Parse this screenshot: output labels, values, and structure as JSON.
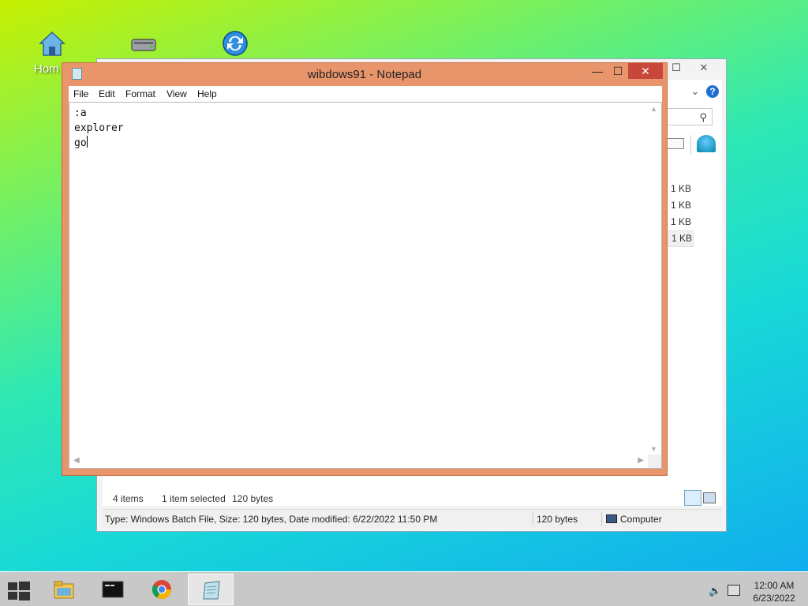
{
  "desktop": {
    "icons": [
      {
        "name": "home-icon",
        "label": "Hom"
      },
      {
        "name": "drive-icon",
        "label": ""
      },
      {
        "name": "sync-icon",
        "label": ""
      }
    ]
  },
  "explorer": {
    "maximize_glyph": "☐",
    "close_glyph": "✕",
    "chevron": "⌄",
    "help": "?",
    "search_icon": "⚲",
    "sizes": [
      "1 KB",
      "1 KB",
      "1 KB",
      "1 KB"
    ],
    "status": {
      "items": "4 items",
      "selected": "1 item selected",
      "bytes": "120 bytes"
    },
    "info": {
      "type_text": "Type: Windows Batch File, Size: 120 bytes, Date modified: 6/22/2022 11:50 PM",
      "size": "120 bytes",
      "location": "Computer"
    }
  },
  "notepad": {
    "title": "wibdows91 - Notepad",
    "min_glyph": "—",
    "max_glyph": "☐",
    "close_glyph": "✕",
    "menu": [
      "File",
      "Edit",
      "Format",
      "View",
      "Help"
    ],
    "lines": [
      ":a",
      "explorer",
      "go"
    ]
  },
  "taskbar": {
    "apps": [
      "file-explorer",
      "command-prompt",
      "chrome",
      "notepad"
    ],
    "active_app": "notepad",
    "clock": {
      "time": "12:00 AM",
      "date": "6/23/2022"
    },
    "speaker_glyph": "🔈"
  },
  "colors": {
    "notepad_frame": "#e8956b",
    "close_button": "#c7483a",
    "taskbar": "#c8c8c8"
  }
}
